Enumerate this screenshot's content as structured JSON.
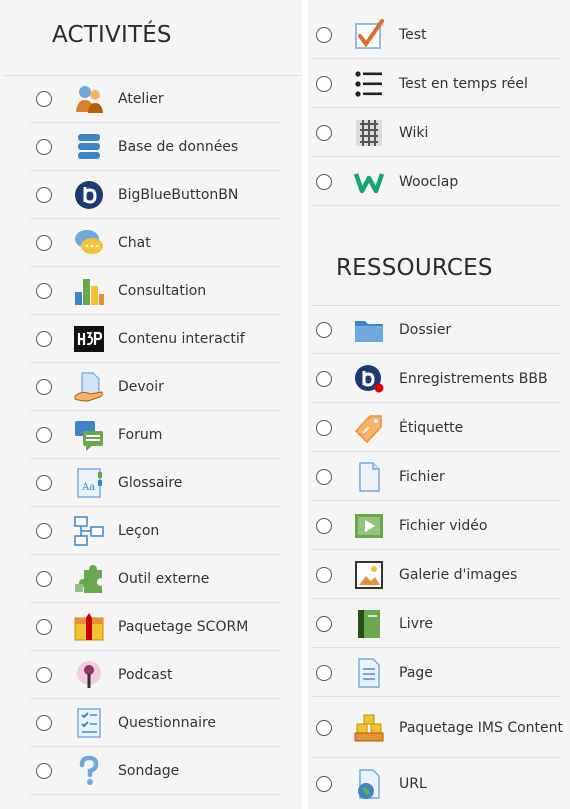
{
  "activities": {
    "heading": "ACTIVITÉS",
    "items": [
      {
        "label": "Atelier",
        "icon": "workshop-icon"
      },
      {
        "label": "Base de données",
        "icon": "database-icon"
      },
      {
        "label": "BigBlueButtonBN",
        "icon": "bigbluebutton-icon"
      },
      {
        "label": "Chat",
        "icon": "chat-icon"
      },
      {
        "label": "Consultation",
        "icon": "choice-chart-icon"
      },
      {
        "label": "Contenu interactif",
        "icon": "h5p-icon"
      },
      {
        "label": "Devoir",
        "icon": "assignment-icon"
      },
      {
        "label": "Forum",
        "icon": "forum-icon"
      },
      {
        "label": "Glossaire",
        "icon": "glossary-icon"
      },
      {
        "label": "Leçon",
        "icon": "lesson-icon"
      },
      {
        "label": "Outil externe",
        "icon": "puzzle-icon"
      },
      {
        "label": "Paquetage SCORM",
        "icon": "scorm-package-icon"
      },
      {
        "label": "Podcast",
        "icon": "podcast-microphone-icon"
      },
      {
        "label": "Questionnaire",
        "icon": "questionnaire-icon"
      },
      {
        "label": "Sondage",
        "icon": "question-mark-icon"
      }
    ]
  },
  "activities_more": {
    "items": [
      {
        "label": "Test",
        "icon": "quiz-checkmark-icon"
      },
      {
        "label": "Test en temps réel",
        "icon": "realtime-quiz-list-icon"
      },
      {
        "label": "Wiki",
        "icon": "wiki-icon"
      },
      {
        "label": "Wooclap",
        "icon": "wooclap-icon"
      }
    ]
  },
  "resources": {
    "heading": "RESSOURCES",
    "items": [
      {
        "label": "Dossier",
        "icon": "folder-icon"
      },
      {
        "label": "Enregistrements BBB",
        "icon": "bbb-recording-icon"
      },
      {
        "label": "Étiquette",
        "icon": "label-tag-icon"
      },
      {
        "label": "Fichier",
        "icon": "file-icon"
      },
      {
        "label": "Fichier vidéo",
        "icon": "video-file-icon"
      },
      {
        "label": "Galerie d'images",
        "icon": "image-gallery-icon"
      },
      {
        "label": "Livre",
        "icon": "book-icon"
      },
      {
        "label": "Page",
        "icon": "page-icon"
      },
      {
        "label": "Paquetage IMS Content",
        "icon": "ims-package-icon"
      },
      {
        "label": "URL",
        "icon": "url-globe-icon"
      }
    ]
  },
  "colors": {
    "panel_bg": "#f5f5f5",
    "separator": "#e0e0e0",
    "text": "#333333"
  }
}
